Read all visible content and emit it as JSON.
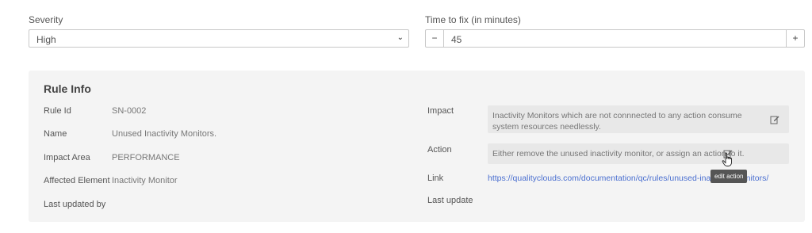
{
  "form": {
    "severity_label": "Severity",
    "severity_value": "High",
    "time_label": "Time to fix (in minutes)",
    "time_value": "45",
    "minus": "−",
    "plus": "+"
  },
  "rule_info": {
    "title": "Rule Info",
    "rule_id_label": "Rule Id",
    "rule_id": "SN-0002",
    "name_label": "Name",
    "name": "Unused Inactivity Monitors.",
    "impact_area_label": "Impact Area",
    "impact_area": "PERFORMANCE",
    "affected_label": "Affected Element",
    "affected": "Inactivity Monitor",
    "last_updated_by_label": "Last updated by",
    "impact_label": "Impact",
    "impact": "Inactivity Monitors which are not connnected to any action consume system resources needlessly.",
    "action_label": "Action",
    "action": "Either remove the unused inactivity monitor, or assign an action to it.",
    "link_label": "Link",
    "link": "https://qualityclouds.com/documentation/qc/rules/unused-inactivity-monitors/",
    "last_update_label": "Last update"
  },
  "tooltip": "edit action",
  "icons": {
    "chevron": "chevron-down-icon",
    "edit": "edit-icon",
    "cursor": "hand-cursor-icon"
  }
}
